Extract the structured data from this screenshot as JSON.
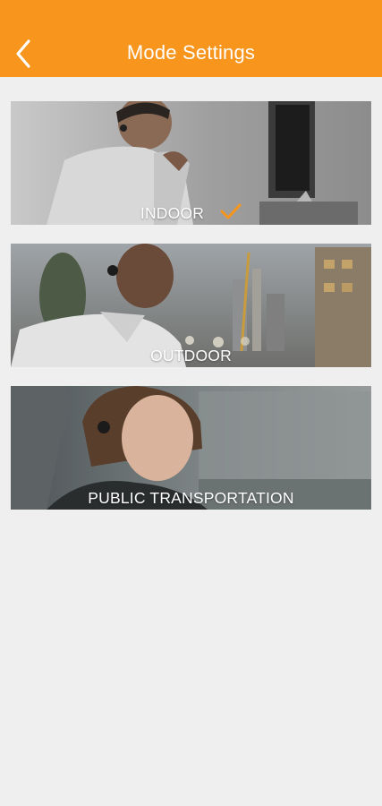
{
  "header": {
    "title": "Mode Settings",
    "back_icon": "chevron-left-icon",
    "color": "#f7951d"
  },
  "modes": [
    {
      "label": "INDOOR",
      "selected": true
    },
    {
      "label": "OUTDOOR",
      "selected": false
    },
    {
      "label": "PUBLIC TRANSPORTATION",
      "selected": false
    }
  ],
  "check_icon": "checkmark-icon",
  "accent_color": "#f7951d"
}
